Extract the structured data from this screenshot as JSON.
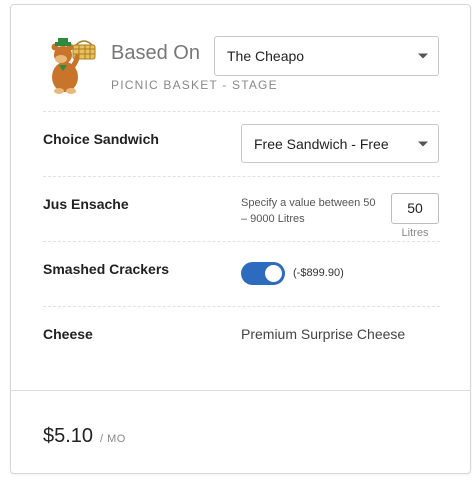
{
  "header": {
    "based_on_label": "Based On",
    "plan_select_value": "The Cheapo",
    "subtitle": "PICNIC BASKET - STAGE",
    "logo_icon": "bear-with-picnic-basket-icon"
  },
  "options": [
    {
      "label": "Choice Sandwich",
      "control": "select",
      "value": "Free Sandwich - Free"
    },
    {
      "label": "Jus Ensache",
      "control": "number",
      "hint": "Specify a value between 50 – 9000 Litres",
      "value": "50",
      "unit": "Litres"
    },
    {
      "label": "Smashed Crackers",
      "control": "toggle",
      "checked": true,
      "price_delta": "(-$899.90)",
      "accent": "#2d6bbf"
    },
    {
      "label": "Cheese",
      "control": "text",
      "value": "Premium Surprise Cheese"
    }
  ],
  "footer": {
    "price": "$5.10",
    "period": "/ MO"
  }
}
